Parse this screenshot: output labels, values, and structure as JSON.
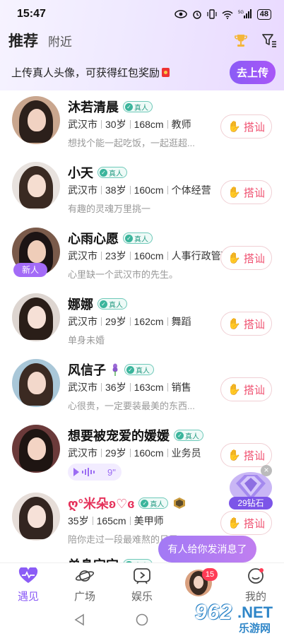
{
  "status": {
    "time": "15:47",
    "battery": "48",
    "network": "5G"
  },
  "header": {
    "tab_recommend": "推荐",
    "tab_nearby": "附近"
  },
  "banner": {
    "text": "上传真人头像，可获得红包奖励",
    "button": "去上传"
  },
  "verified_label": "真人",
  "chat_label": "搭讪",
  "users": [
    {
      "name": "沐若清晨",
      "city": "武汉市",
      "age": "30岁",
      "height": "168cm",
      "job": "教师",
      "bio": "想找个能一起吃饭，一起逛超...",
      "verified": true
    },
    {
      "name": "小天",
      "city": "武汉市",
      "age": "38岁",
      "height": "160cm",
      "job": "个体经营",
      "bio": "有趣的灵魂万里挑一",
      "verified": true
    },
    {
      "name": "心雨心愿",
      "city": "武汉市",
      "age": "23岁",
      "height": "160cm",
      "job": "人事行政管理",
      "bio": "心里缺一个武汉市的先生。",
      "verified": true,
      "badge": "新人"
    },
    {
      "name": "娜娜",
      "city": "武汉市",
      "age": "29岁",
      "height": "162cm",
      "job": "舞蹈",
      "bio": "单身未婚",
      "verified": true
    },
    {
      "name": "风信子",
      "city": "武汉市",
      "age": "36岁",
      "height": "163cm",
      "job": "销售",
      "bio": "心很贵，一定要装最美的东西...",
      "verified": true
    },
    {
      "name": "想要被宠爱的媛媛",
      "city": "武汉市",
      "age": "29岁",
      "height": "160cm",
      "job": "业务员",
      "bio": "",
      "verified": true,
      "voice": "9\""
    },
    {
      "name": "ღ°米朵ʚ♡ɞ",
      "city": "",
      "age": "35岁",
      "height": "165cm",
      "job": "美甲师",
      "bio": "陪你走过一段最难熬的日子",
      "verified": true
    },
    {
      "name": "单身宝宝",
      "city": "",
      "age": "",
      "height": "",
      "job": "",
      "bio": "",
      "verified": true
    }
  ],
  "gift": {
    "label": "29钻石"
  },
  "toast": "有人给你发消息了",
  "nav": {
    "meet": "遇见",
    "square": "广场",
    "fun": "娱乐",
    "mine": "我的",
    "msg_badge": "15"
  },
  "watermark": {
    "num": "962",
    "net": ".NET",
    "sub": "乐游网"
  },
  "colors": {
    "accent": "#8b5cf6",
    "chat": "#ef4f6f",
    "verified": "#2a9d86"
  }
}
